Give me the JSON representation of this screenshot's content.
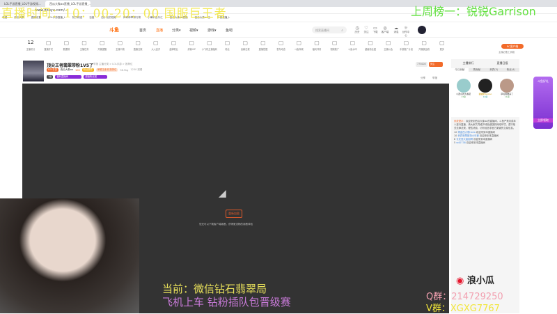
{
  "browser": {
    "tabs": [
      "LOL手游直播_LOL手游视频...",
      "西瓜大象ao直播_LOL手游直播_..."
    ],
    "url": "www.douyu.com/...",
    "bookmarks": [
      "收藏",
      "西瓜大象",
      "直播设置",
      "LOL手游直播_L",
      "知乎精选",
      "百度",
      "西小瓜的视频",
      "神奇种草排行榜",
      "小喇叭音乐汇",
      "西瓜大象ao直播",
      "西瓜大象ao主",
      "抖音直播_L"
    ]
  },
  "header": {
    "logo": "斗鱼",
    "nav": [
      "首页",
      "直播",
      "分类▾",
      "视频▾",
      "游戏▾",
      "鱼吧"
    ],
    "search_placeholder": "搜索直播间",
    "icons": [
      {
        "label": "历史",
        "glyph": "◷"
      },
      {
        "label": "关注",
        "glyph": "♡"
      },
      {
        "label": "下载",
        "glyph": "▭"
      },
      {
        "label": "客户端",
        "glyph": "◎"
      },
      {
        "label": "消息",
        "glyph": "☁"
      },
      {
        "label": "创作中心",
        "glyph": "☼"
      }
    ]
  },
  "icon_row": {
    "level": "12",
    "items": [
      "主播积分",
      "直播开关",
      "数据榜",
      "主播任务",
      "开播提醒",
      "主播口袋",
      "直播日报",
      "大火连开",
      "金牌职业",
      "房管VIP",
      "小飞机主播福利",
      "粉丝",
      "贡献日报",
      "直播挖掘",
      "发布动态",
      "斗鱼商城",
      "福利详情",
      "视频推广",
      "斗鱼水印",
      "超级粉丝团",
      "主播公会",
      "手游推广计划",
      "开播挑战赛",
      "更多"
    ],
    "pc_button": "PC客户端",
    "pc_sub": "主播必备工具箱"
  },
  "room": {
    "title": "顶尖王者翡翠带粉1V5了",
    "sub": "举报  主播分类 > LOL手游 > 推荐位",
    "tags": [
      "LOL手游",
      "西瓜大象ao",
      "100",
      "粉丝徽章",
      "荣耀王者·精英排位",
      "98.9kg",
      "1230 观看"
    ],
    "badges": [
      "1级",
      "福利直播间",
      "超级粉丝团"
    ],
    "fans": "775008",
    "follow": "关注",
    "share": "分享",
    "report": "举报"
  },
  "video": {
    "button": "重新加载",
    "hint": "您还可以下载客户端观看，获得更流畅的观看体验"
  },
  "chat": {
    "tabs": [
      "主播排行",
      "直播日报"
    ],
    "rank_tabs": [
      "今日贡献",
      "周贡献",
      "贵宾(3)",
      "粉丝(4)"
    ],
    "top": [
      {
        "name": "小西瓜的大番茄",
        "level": "13级"
      },
      {
        "name": "猫猫的Goooo",
        "level": "12级"
      },
      {
        "name": "草莓蛋糕来了",
        "level": "11级"
      }
    ],
    "system_label": "系统提示：",
    "system_msg": "欢迎来到西瓜大象ao的直播间，斗鱼严禁未成年人进行直播，请大家共同维护绿色健康的网络环境，遵守相关法律法规，理性消费，切勿轻信非官方渠道的交易信息。",
    "messages": [
      {
        "lv": "12",
        "user": "博金西大爸haha",
        "text": "欢迎来到本直播间"
      },
      {
        "lv": "10",
        "user": "贵宾翡翠猎场小可爱",
        "text": "欢迎来到本直播间"
      },
      {
        "lv": "8",
        "user": "长花西大姐姐啊",
        "text": "欢迎来到本直播间"
      },
      {
        "lv": "5",
        "user": "w40738",
        "text": "欢迎来到本直播间"
      }
    ]
  },
  "ad": {
    "title": "斗鱼好礼",
    "btn": "立即领取"
  },
  "overlay": {
    "top_left": "直播时间：10：00-20：00  国服巨王者",
    "top_right": "上周榜一：锐锐Garrison",
    "line1": "当前：微信钻石翡翠局",
    "line2": "飞机上车 钻粉插队包晋级赛",
    "weibo": "浪小瓜",
    "qq": "Q群：214729250",
    "vx": "V群：XGXG7767"
  }
}
